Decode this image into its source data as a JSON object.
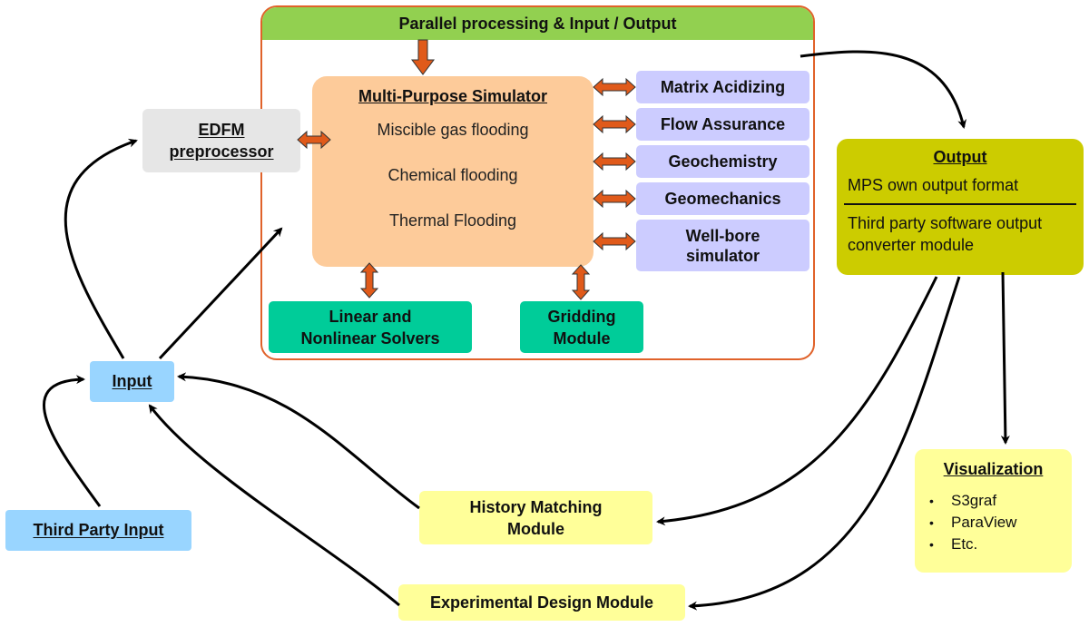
{
  "diagram": {
    "frame": {
      "header": "Parallel processing & Input / Output"
    },
    "simulator": {
      "title": "Multi-Purpose Simulator",
      "items": [
        "Miscible gas flooding",
        "Chemical flooding",
        "Thermal Flooding"
      ]
    },
    "modules": [
      {
        "label": "Matrix Acidizing"
      },
      {
        "label": "Flow Assurance"
      },
      {
        "label": "Geochemistry"
      },
      {
        "label": "Geomechanics"
      },
      {
        "label": "Well-bore simulator",
        "line1": "Well-bore",
        "line2": "simulator"
      }
    ],
    "solvers": {
      "line1": "Linear and",
      "line2": "Nonlinear Solvers"
    },
    "gridding": {
      "line1": "Gridding",
      "line2": "Module"
    },
    "edfm": {
      "line1": "EDFM",
      "line2": "preprocessor"
    },
    "input": {
      "label": "Input"
    },
    "third_party_input": {
      "label": "Third Party Input"
    },
    "output": {
      "title": "Output",
      "line1": "MPS own output format",
      "line2a": "Third party software output",
      "line2b": "converter module"
    },
    "visualization": {
      "title": "Visualization",
      "items": [
        "S3graf",
        "ParaView",
        "Etc."
      ]
    },
    "history_matching": {
      "line1": "History Matching",
      "line2": "Module"
    },
    "experimental_design": {
      "label": "Experimental Design Module"
    },
    "colors": {
      "frame_border": "#e0622a",
      "frame_header": "#92d050",
      "simulator": "#fdcb9a",
      "module": "#ccccff",
      "solver": "#00cc99",
      "edfm": "#e6e6e6",
      "input": "#99d5ff",
      "output": "#cccc00",
      "yellow_box": "#ffff99",
      "orange_arrow": "#e05a1a"
    }
  }
}
